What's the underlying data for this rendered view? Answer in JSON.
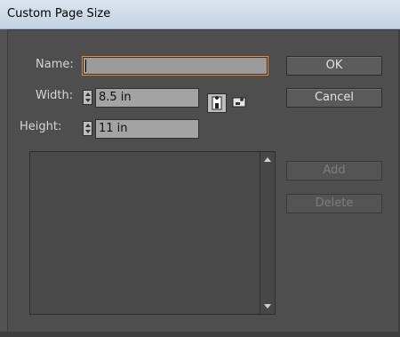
{
  "window": {
    "title": "Custom Page Size"
  },
  "form": {
    "name_label": "Name:",
    "name_value": "",
    "width_label": "Width:",
    "width_value": "8.5 in",
    "height_label": "Height:",
    "height_value": "11 in"
  },
  "orientation": {
    "selected": "portrait",
    "icons": [
      "portrait-orientation-icon",
      "landscape-orientation-icon"
    ]
  },
  "buttons": {
    "ok": "OK",
    "cancel": "Cancel",
    "add": "Add",
    "delete": "Delete"
  },
  "page_sizes_list": {
    "items": []
  },
  "colors": {
    "accent_focus": "#f28c2a",
    "panel": "#535353"
  }
}
